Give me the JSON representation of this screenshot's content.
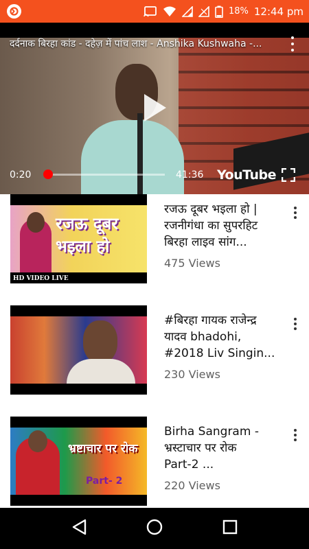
{
  "status_bar": {
    "battery": "18%",
    "time": "12:44 pm",
    "icons": [
      "app-badge-icon",
      "cast-icon",
      "wifi-icon",
      "signal-icon",
      "signal-empty-icon",
      "battery-icon"
    ]
  },
  "player": {
    "title": "दर्दनाक बिरहा कांड - दहेज़ में पांच लाश - Anshika Kushwaha -...",
    "current_time": "0:20",
    "total_time": "41:36",
    "progress": 0.008,
    "logo": "YouTube",
    "icons": [
      "play-icon",
      "more-vert-icon",
      "fullscreen-icon"
    ]
  },
  "videos": [
    {
      "title_lines": [
        "रजऊ दूबर भइला हो |",
        "रजनीगंधा का सुपरहिट",
        "बिरहा लाइव सांग..."
      ],
      "views": "475 Views",
      "thumb_text": "रजऊ दूबर भइला हो",
      "thumb_caption": "HD VIDEO LIVE"
    },
    {
      "title_lines": [
        "#बिरहा गायक राजेन्द्र",
        "यादव bhadohi,",
        "#2018 Liv Singin..."
      ],
      "views": "230 Views",
      "thumb_text": "",
      "thumb_caption": ""
    },
    {
      "title_lines": [
        "Birha Sangram -",
        "भ्रस्टाचार पर रोक",
        "Part-2 ..."
      ],
      "views": "220 Views",
      "thumb_text": "भ्रष्टाचार पर रोक",
      "thumb_caption": "Part- 2"
    }
  ],
  "nav": {
    "icons": [
      "back-icon",
      "home-icon",
      "recents-icon"
    ]
  }
}
